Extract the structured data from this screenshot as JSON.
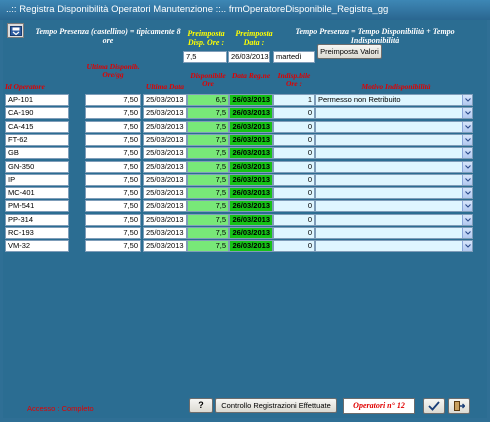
{
  "window": {
    "title": "..:: Registra Disponibilità Operatori Manutenzione ::..    frmOperatoreDisponibile_Registra_gg"
  },
  "header": {
    "tempo_presenza_note": "Tempo Presenza (castellino) = tipicamente 8 ore",
    "preimposta_ore_label": "Preimposta Disp. Ore :",
    "preimposta_data_label": "Preimposta Data :",
    "formula_note": "Tempo Presenza = Tempo Disponibilità + Tempo Indisponibilità",
    "ore_value": "7,5",
    "data_value": "26/03/2013",
    "weekday_value": "martedì",
    "preimposta_button": "Preimposta Valori"
  },
  "columns": {
    "id_operatore": "Id Operatore",
    "ultima_disponib": "Ultima Disponib. Ore/gg",
    "ultima_data": "Ultima Data",
    "disponibile_ore": "Disponibile Ore",
    "data_reg": "Data Reg.ne",
    "indisponibile_ore": "Indisp.bile Ore :",
    "motivo": "Motivo Indisponibilità"
  },
  "rows": [
    {
      "id": "AP-101",
      "ultima_ore": "7,50",
      "ultima_data": "25/03/2013",
      "disp_ore": "6,5",
      "data_reg": "26/03/2013",
      "indisp_ore": "1",
      "motivo": "Permesso non Retribuito"
    },
    {
      "id": "CA-190",
      "ultima_ore": "7,50",
      "ultima_data": "25/03/2013",
      "disp_ore": "7,5",
      "data_reg": "26/03/2013",
      "indisp_ore": "0",
      "motivo": ""
    },
    {
      "id": "CA-415",
      "ultima_ore": "7,50",
      "ultima_data": "25/03/2013",
      "disp_ore": "7,5",
      "data_reg": "26/03/2013",
      "indisp_ore": "0",
      "motivo": ""
    },
    {
      "id": "FT-62",
      "ultima_ore": "7,50",
      "ultima_data": "25/03/2013",
      "disp_ore": "7,5",
      "data_reg": "26/03/2013",
      "indisp_ore": "0",
      "motivo": ""
    },
    {
      "id": "GB",
      "ultima_ore": "7,50",
      "ultima_data": "25/03/2013",
      "disp_ore": "7,5",
      "data_reg": "26/03/2013",
      "indisp_ore": "0",
      "motivo": ""
    },
    {
      "id": "GN-350",
      "ultima_ore": "7,50",
      "ultima_data": "25/03/2013",
      "disp_ore": "7,5",
      "data_reg": "26/03/2013",
      "indisp_ore": "0",
      "motivo": ""
    },
    {
      "id": "IP",
      "ultima_ore": "7,50",
      "ultima_data": "25/03/2013",
      "disp_ore": "7,5",
      "data_reg": "26/03/2013",
      "indisp_ore": "0",
      "motivo": ""
    },
    {
      "id": "MC-401",
      "ultima_ore": "7,50",
      "ultima_data": "25/03/2013",
      "disp_ore": "7,5",
      "data_reg": "26/03/2013",
      "indisp_ore": "0",
      "motivo": ""
    },
    {
      "id": "PM-541",
      "ultima_ore": "7,50",
      "ultima_data": "25/03/2013",
      "disp_ore": "7,5",
      "data_reg": "26/03/2013",
      "indisp_ore": "0",
      "motivo": ""
    },
    {
      "id": "PP-314",
      "ultima_ore": "7,50",
      "ultima_data": "25/03/2013",
      "disp_ore": "7,5",
      "data_reg": "26/03/2013",
      "indisp_ore": "0",
      "motivo": ""
    },
    {
      "id": "RC-193",
      "ultima_ore": "7,50",
      "ultima_data": "25/03/2013",
      "disp_ore": "7,5",
      "data_reg": "26/03/2013",
      "indisp_ore": "0",
      "motivo": ""
    },
    {
      "id": "VM-32",
      "ultima_ore": "7,50",
      "ultima_data": "25/03/2013",
      "disp_ore": "7,5",
      "data_reg": "26/03/2013",
      "indisp_ore": "0",
      "motivo": ""
    }
  ],
  "footer": {
    "accesso": "Accesso : Completo",
    "controllo_button": "Controllo Registrazioni Effettuate",
    "operatori_label": "Operatori  n° 12"
  },
  "icons": {
    "top_left": "save-form-icon",
    "help": "question-mark-icon",
    "confirm": "check-icon",
    "exit": "exit-door-icon",
    "dropdown": "chevron-down-icon"
  },
  "colors": {
    "background": "#2b6d92",
    "disponibile": "#78e878",
    "data_reg": "#16c216",
    "indisponibile": "#dff6ff",
    "label_red": "#e00000",
    "label_yellow": "#ffff00"
  }
}
